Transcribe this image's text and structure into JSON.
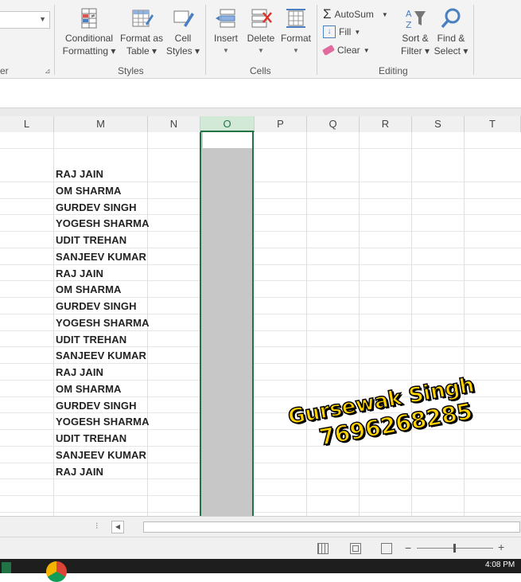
{
  "ribbon": {
    "styles": {
      "conditional_formatting": [
        "Conditional",
        "Formatting ▾"
      ],
      "format_as_table": [
        "Format as",
        "Table ▾"
      ],
      "cell_styles": [
        "Cell",
        "Styles ▾"
      ],
      "group_label": "Styles"
    },
    "cells": {
      "insert": "Insert",
      "delete": "Delete",
      "format": "Format",
      "group_label": "Cells"
    },
    "editing": {
      "autosum": "AutoSum",
      "fill": "Fill",
      "clear": "Clear",
      "sort_filter": [
        "Sort &",
        "Filter ▾"
      ],
      "find_select": [
        "Find &",
        "Select ▾"
      ],
      "group_label": "Editing"
    },
    "left_group_label": "er"
  },
  "columns": [
    "L",
    "M",
    "N",
    "O",
    "P",
    "Q",
    "R",
    "S",
    "T"
  ],
  "selected_column": "O",
  "names": [
    "RAJ JAIN",
    "OM SHARMA",
    "GURDEV SINGH",
    "YOGESH SHARMA",
    "UDIT TREHAN",
    "SANJEEV KUMAR",
    "RAJ JAIN",
    "OM SHARMA",
    "GURDEV SINGH",
    "YOGESH SHARMA",
    "UDIT TREHAN",
    "SANJEEV KUMAR",
    "RAJ JAIN",
    "OM SHARMA",
    "GURDEV SINGH",
    "YOGESH SHARMA",
    "UDIT TREHAN",
    "SANJEEV KUMAR",
    "RAJ JAIN"
  ],
  "watermark": {
    "name": "Gursewak Singh",
    "phone": "7696268285"
  },
  "taskbar": {
    "time": "4:08 PM"
  },
  "colors": {
    "excel_green": "#217346",
    "watermark_yellow": "#ffd200"
  }
}
